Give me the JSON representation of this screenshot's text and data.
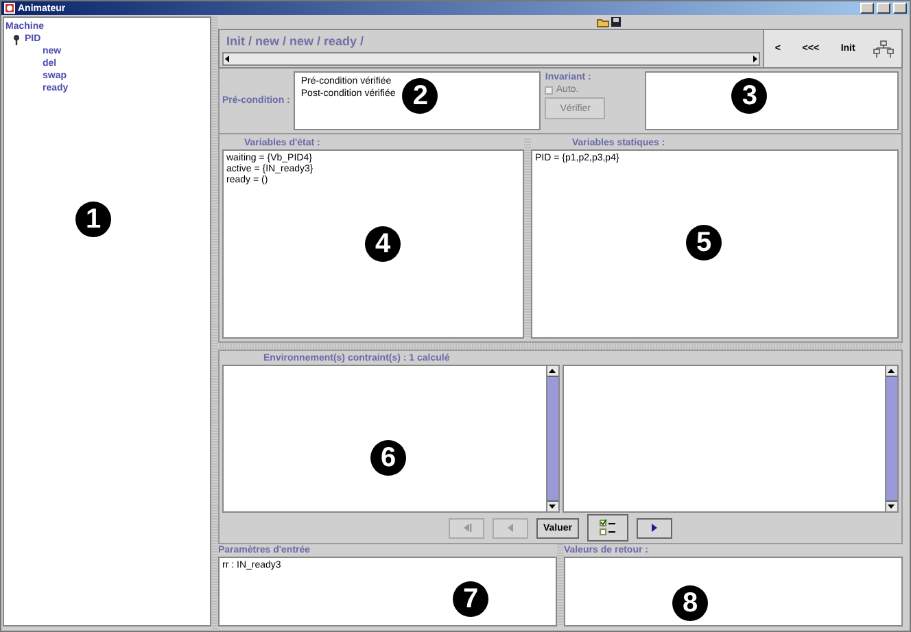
{
  "window": {
    "title": "Animateur"
  },
  "tree": {
    "label": "Machine",
    "callout": "1",
    "children": [
      {
        "label": "PID",
        "expanded": true,
        "children": [
          {
            "label": "new"
          },
          {
            "label": "del"
          },
          {
            "label": "swap"
          },
          {
            "label": "ready"
          }
        ]
      }
    ]
  },
  "trace": {
    "path": "Init / new / new / ready /"
  },
  "navigation": [
    {
      "label": "<"
    },
    {
      "label": "<<<"
    },
    {
      "label": "Init"
    }
  ],
  "conditions": {
    "label": "Pré-condition :",
    "lines": [
      "Pré-condition vérifiée",
      "Post-condition vérifiée"
    ],
    "callout": "2"
  },
  "invariant": {
    "label": "Invariant :",
    "auto": {
      "label": "Auto.",
      "checked": false,
      "disabled": true
    },
    "verify": {
      "label": "Vérifier",
      "disabled": true
    },
    "callout": "3"
  },
  "state_variables": {
    "title": "Variables d'état :",
    "lines": [
      "waiting = {Vb_PID4}",
      "active = {IN_ready3}",
      "ready = ()"
    ],
    "callout": "4"
  },
  "static_variables": {
    "title": "Variables statiques :",
    "lines": [
      "PID = {p1,p2,p3,p4}"
    ],
    "callout": "5"
  },
  "environments": {
    "title": "Environnement(s) contraint(s) : 1 calculé",
    "callout": "6"
  },
  "valuation_buttons": [
    {
      "kind": "first",
      "disabled": true
    },
    {
      "kind": "prev",
      "disabled": true
    },
    {
      "kind": "text",
      "label": "Valuer",
      "disabled": false
    },
    {
      "kind": "check",
      "disabled": false
    },
    {
      "kind": "next",
      "disabled": false
    }
  ],
  "input_parameters": {
    "title": "Paramètres d'entrée",
    "lines": [
      "rr : IN_ready3"
    ],
    "callout": "7"
  },
  "return_values": {
    "title": "Valeurs de retour :",
    "callout": "8"
  }
}
